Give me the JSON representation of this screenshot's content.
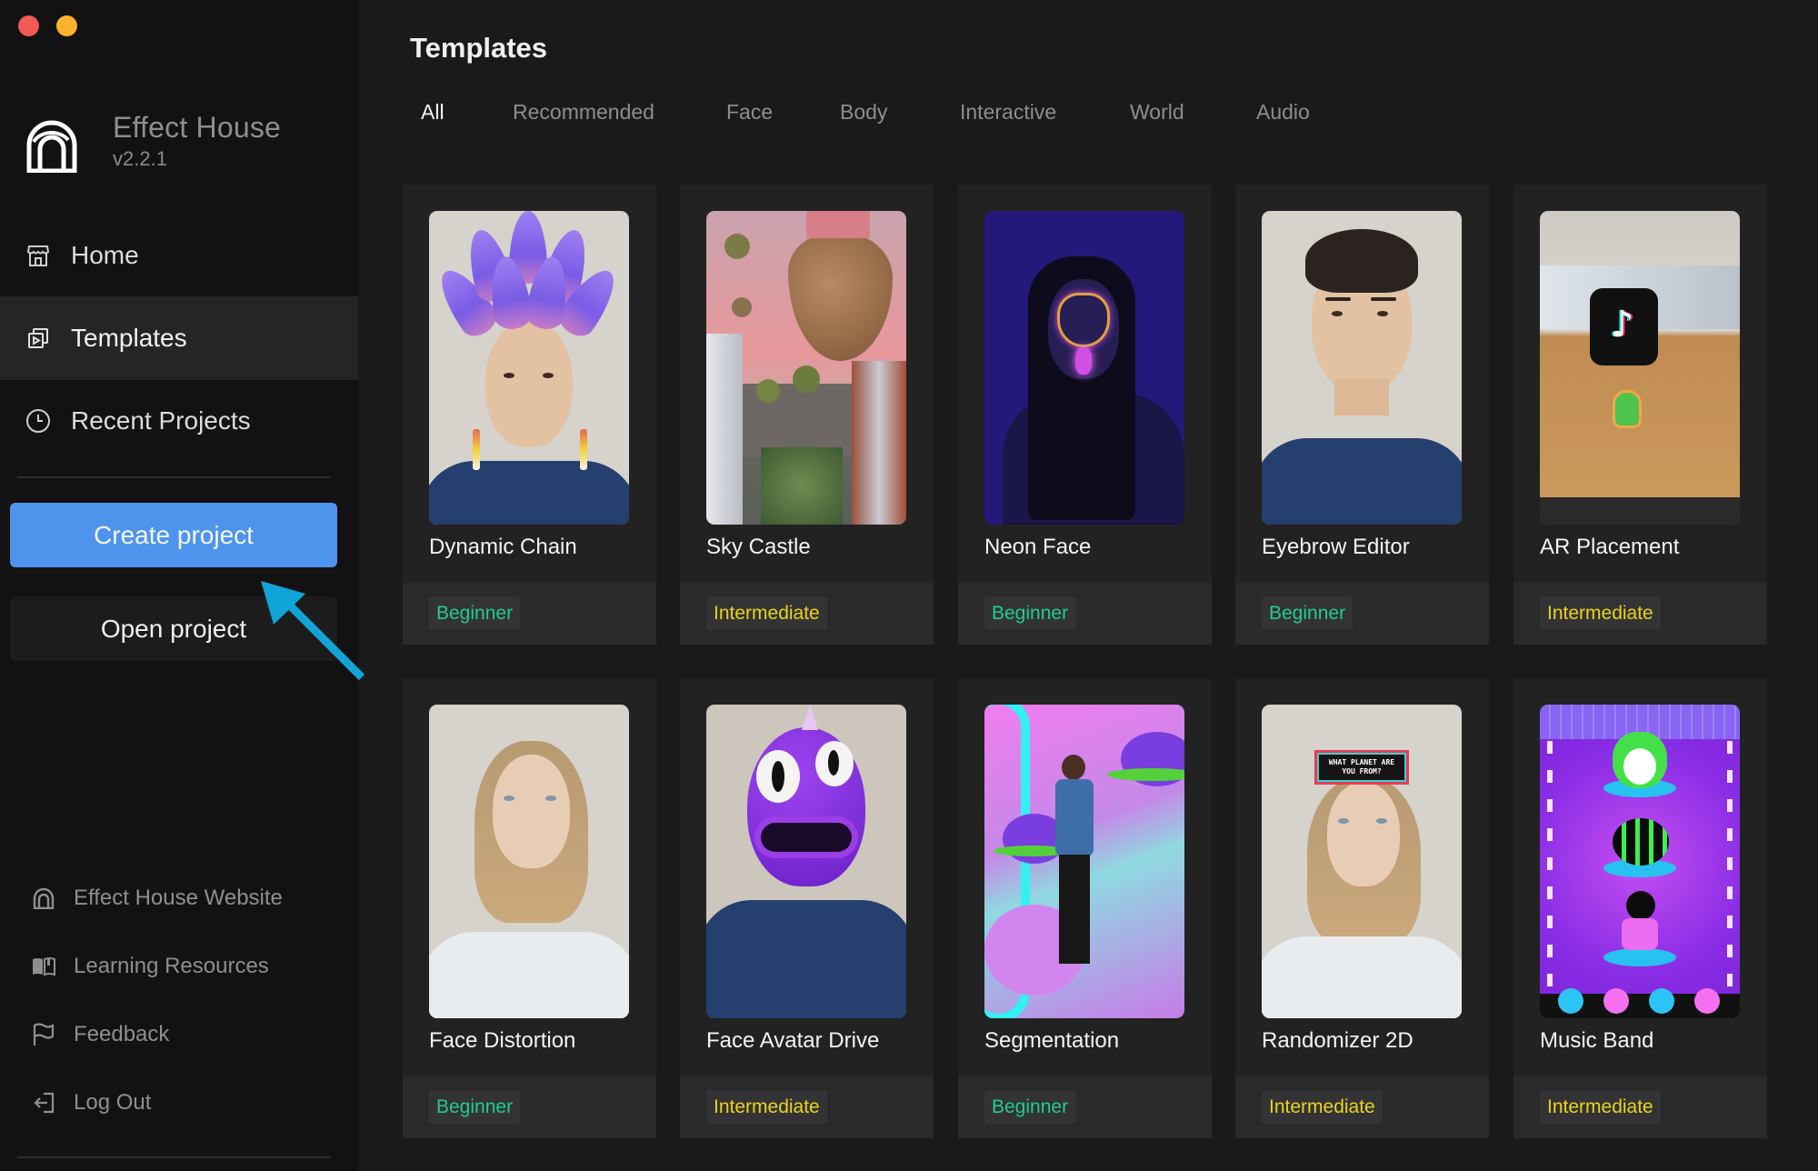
{
  "window": {
    "controls": [
      "close",
      "minimize"
    ]
  },
  "app": {
    "name": "Effect House",
    "version": "v2.2.1",
    "logo_icon": "effect-house-arch-icon"
  },
  "sidebar": {
    "nav": [
      {
        "label": "Home",
        "icon": "storefront-icon",
        "active": false
      },
      {
        "label": "Templates",
        "icon": "templates-icon",
        "active": true
      },
      {
        "label": "Recent Projects",
        "icon": "clock-icon",
        "active": false
      }
    ],
    "create_project_label": "Create project",
    "open_project_label": "Open project",
    "links": [
      {
        "label": "Effect House Website",
        "icon": "effect-house-icon"
      },
      {
        "label": "Learning Resources",
        "icon": "book-icon"
      },
      {
        "label": "Feedback",
        "icon": "flag-icon"
      },
      {
        "label": "Log Out",
        "icon": "logout-icon"
      }
    ]
  },
  "main": {
    "title": "Templates",
    "tabs": [
      {
        "label": "All",
        "active": true
      },
      {
        "label": "Recommended",
        "active": false
      },
      {
        "label": "Face",
        "active": false
      },
      {
        "label": "Body",
        "active": false
      },
      {
        "label": "Interactive",
        "active": false
      },
      {
        "label": "World",
        "active": false
      },
      {
        "label": "Audio",
        "active": false
      }
    ],
    "templates": [
      {
        "title": "Dynamic Chain",
        "level": "Beginner"
      },
      {
        "title": "Sky Castle",
        "level": "Intermediate"
      },
      {
        "title": "Neon Face",
        "level": "Beginner"
      },
      {
        "title": "Eyebrow Editor",
        "level": "Beginner"
      },
      {
        "title": "AR Placement",
        "level": "Intermediate"
      },
      {
        "title": "Face Distortion",
        "level": "Beginner"
      },
      {
        "title": "Face Avatar Drive",
        "level": "Intermediate"
      },
      {
        "title": "Segmentation",
        "level": "Beginner"
      },
      {
        "title": "Randomizer 2D",
        "level": "Intermediate",
        "sign_text": "WHAT PLANET ARE YOU FROM?"
      },
      {
        "title": "Music Band",
        "level": "Intermediate"
      }
    ]
  },
  "colors": {
    "accent": "#4e94ec",
    "beginner": "#22cd8c",
    "intermediate": "#ead41c",
    "annotation_arrow": "#11a4d8"
  }
}
